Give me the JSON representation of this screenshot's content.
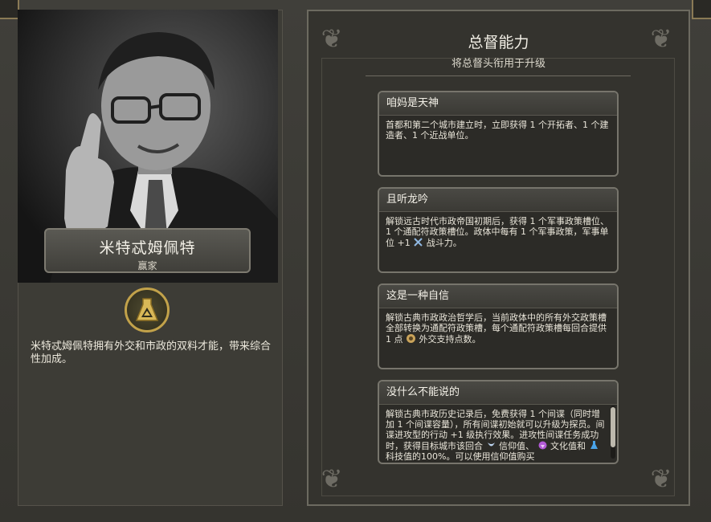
{
  "leader": {
    "name": "米特忒姆佩特",
    "title": "赢家",
    "ability_description": "米特忒姆佩特拥有外交和市政的双料才能，带来综合性加成。"
  },
  "governor_panel": {
    "title": "总督能力",
    "subtitle": "将总督头衔用于升级",
    "promotions": [
      {
        "name": "咱妈是天神",
        "description": "首都和第二个城市建立时，立即获得 1 个开拓者、1 个建造者、1 个近战单位。"
      },
      {
        "name": "且听龙吟",
        "description_part1": "解锁远古时代市政帝国初期后，获得 1 个军事政策槽位、1 个通配符政策槽位。政体中每有 1 个军事政策，军事单位 +1",
        "description_part2": "战斗力。"
      },
      {
        "name": "这是一种自信",
        "description_part1": "解锁古典市政政治哲学后，当前政体中的所有外交政策槽全部转换为通配符政策槽，每个通配符政策槽每回合提供 1 点",
        "description_part2": "外交支持点数。"
      },
      {
        "name": "没什么不能说的",
        "description_part1": "解锁古典市政历史记录后，免费获得 1 个间谍（同时增加 1 个间谍容量），所有间谍初始就可以升级为探员。间谍进攻型的行动 +1 级执行效果。进攻性间谍任务成功时，获得目标城市该回合",
        "description_part2": "信仰值、",
        "description_part3": "文化值和",
        "description_part4": "科技值的100%。可以使用信仰值购买"
      }
    ]
  },
  "colors": {
    "badge_gold": "#c2a24a",
    "panel_border": "#77756c",
    "combat_icon": "#8fb7e0",
    "diplomatic_icon": "#c9a35a",
    "faith_icon": "#bcd4f0",
    "culture_icon": "#b25ad6",
    "science_icon": "#4aa3e8"
  },
  "icons": {
    "badge": "triangle-flask-icon",
    "combat": "crossed-swords-icon",
    "diplomatic": "diplomatic-favor-icon",
    "faith": "faith-icon",
    "culture": "culture-icon",
    "science": "science-icon"
  }
}
